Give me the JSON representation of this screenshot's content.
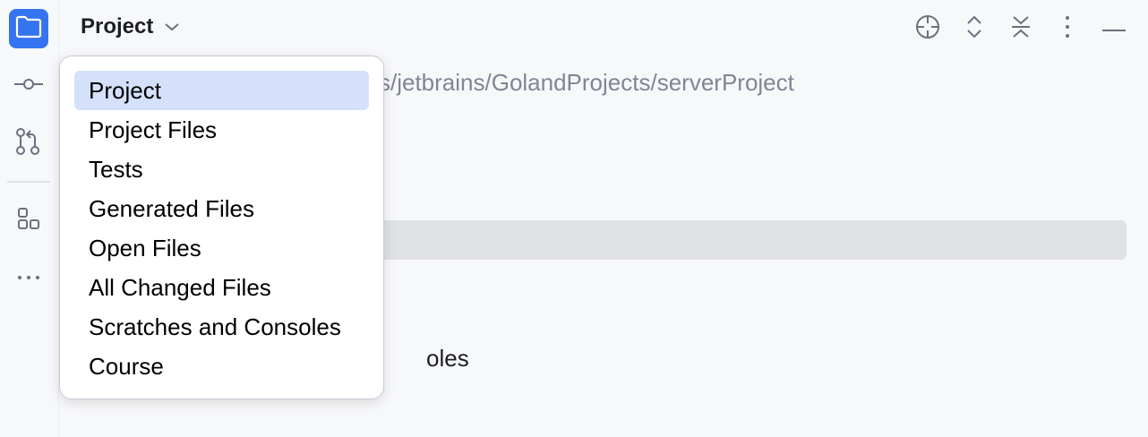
{
  "stripe": {
    "buttons": [
      {
        "name": "project-tool-button",
        "icon": "folder-icon",
        "active": true
      },
      {
        "name": "commit-tool-button",
        "icon": "commit-icon"
      },
      {
        "name": "pull-requests-tool-button",
        "icon": "pull-request-icon"
      },
      {
        "name": "structure-tool-button",
        "icon": "structure-icon"
      },
      {
        "name": "more-tools-button",
        "icon": "more-horizontal-icon"
      }
    ]
  },
  "panel": {
    "title": "Project",
    "path_text": "s/jetbrains/GolandProjects/serverProject",
    "behind_text": "oles",
    "tool_icons": [
      "locate-icon",
      "expand-all-icon",
      "collapse-all-icon",
      "more-vertical-icon",
      "minimize-icon"
    ]
  },
  "popup": {
    "items": [
      {
        "label": "Project",
        "selected": true
      },
      {
        "label": "Project Files"
      },
      {
        "label": "Tests"
      },
      {
        "label": "Generated Files"
      },
      {
        "label": "Open Files"
      },
      {
        "label": "All Changed Files"
      },
      {
        "label": "Scratches and Consoles"
      },
      {
        "label": "Course"
      }
    ]
  },
  "colors": {
    "accent": "#3574f0",
    "selection": "#d5e1fb",
    "background": "#f7f8fa"
  }
}
